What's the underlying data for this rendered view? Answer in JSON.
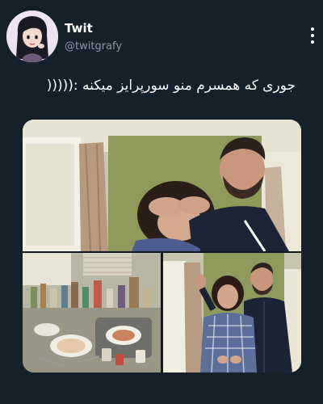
{
  "author": {
    "display_name": "Twit",
    "handle": "@twitgrafy",
    "avatar_icon": "cartoon-girl-avatar-icon"
  },
  "tweet": {
    "text": "جوری که همسرم منو سورپرایز میکنه :((((("
  },
  "media": {
    "photos": [
      {
        "description_icon": "man-covering-woman-eyes-photo"
      },
      {
        "description_icon": "messy-dishes-sink-photo"
      },
      {
        "description_icon": "man-and-woman-in-kitchen-photo"
      }
    ]
  },
  "colors": {
    "background": "#15202b",
    "text_primary": "#ffffff",
    "text_secondary": "#8b98a5"
  }
}
